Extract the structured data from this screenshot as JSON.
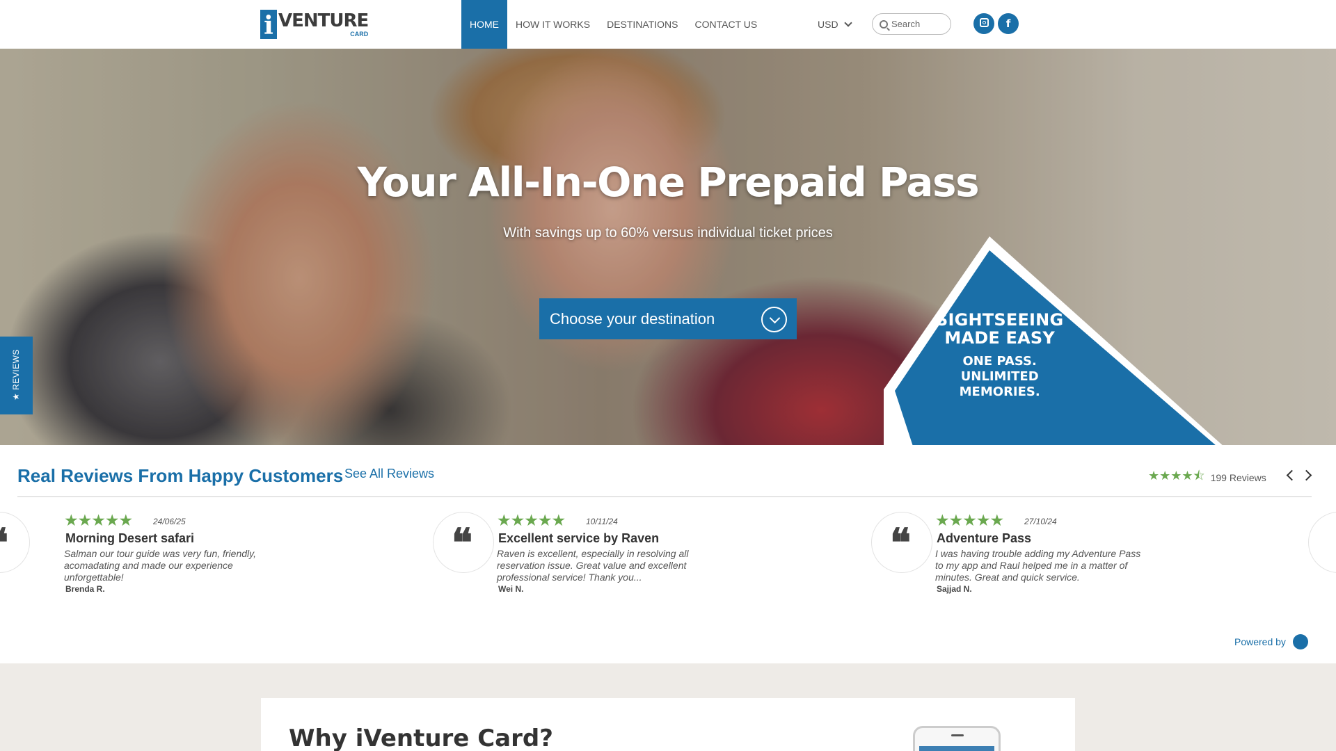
{
  "header": {
    "logo_text": "VENTURE",
    "logo_letter": "i",
    "logo_sub": "CARD",
    "nav": [
      {
        "label": "HOME",
        "active": true
      },
      {
        "label": "HOW IT WORKS",
        "active": false
      },
      {
        "label": "DESTINATIONS",
        "active": false
      },
      {
        "label": "CONTACT US",
        "active": false
      }
    ],
    "currency": "USD",
    "search_placeholder": "Search",
    "social": [
      {
        "name": "instagram-icon"
      },
      {
        "name": "facebook-icon",
        "glyph": "f"
      }
    ]
  },
  "hero": {
    "title": "Your All-In-One Prepaid Pass",
    "subtitle": "With savings up to 60% versus individual ticket prices",
    "cta": "Choose your destination",
    "badge_line1a": "SIGHTSEEING",
    "badge_line1b": "MADE EASY",
    "badge_line2a": "ONE PASS.",
    "badge_line2b": "UNLIMITED",
    "badge_line2c": "MEMORIES.",
    "reviews_tab": "★ REVIEWS"
  },
  "reviews": {
    "title": "Real Reviews From Happy Customers",
    "see_all": "See All Reviews",
    "summary_stars": "★★★★⯪",
    "count": "199 Reviews",
    "cards": [
      {
        "stars": "★★★★★",
        "date": "24/06/25",
        "title": "Morning Desert safari",
        "body": "Salman our tour guide was very fun, friendly, acomadating and made our experience unforgettable!",
        "author": "Brenda R."
      },
      {
        "stars": "★★★★★",
        "date": "10/11/24",
        "title": "Excellent service by Raven",
        "body": "Raven is excellent, especially in resolving all reservation issue. Great value and excellent professional service! Thank you...",
        "author": "Wei N."
      },
      {
        "stars": "★★★★★",
        "date": "27/10/24",
        "title": "Adventure Pass",
        "body": "I was having trouble adding my Adventure Pass to my app and Raul helped me in a matter of minutes. Great and quick service.",
        "author": "Sajjad N."
      }
    ],
    "powered_by": "Powered by"
  },
  "why": {
    "title": "Why iVenture Card?"
  },
  "colors": {
    "brand_blue": "#1a6fa8",
    "star_green": "#6aa84f"
  }
}
